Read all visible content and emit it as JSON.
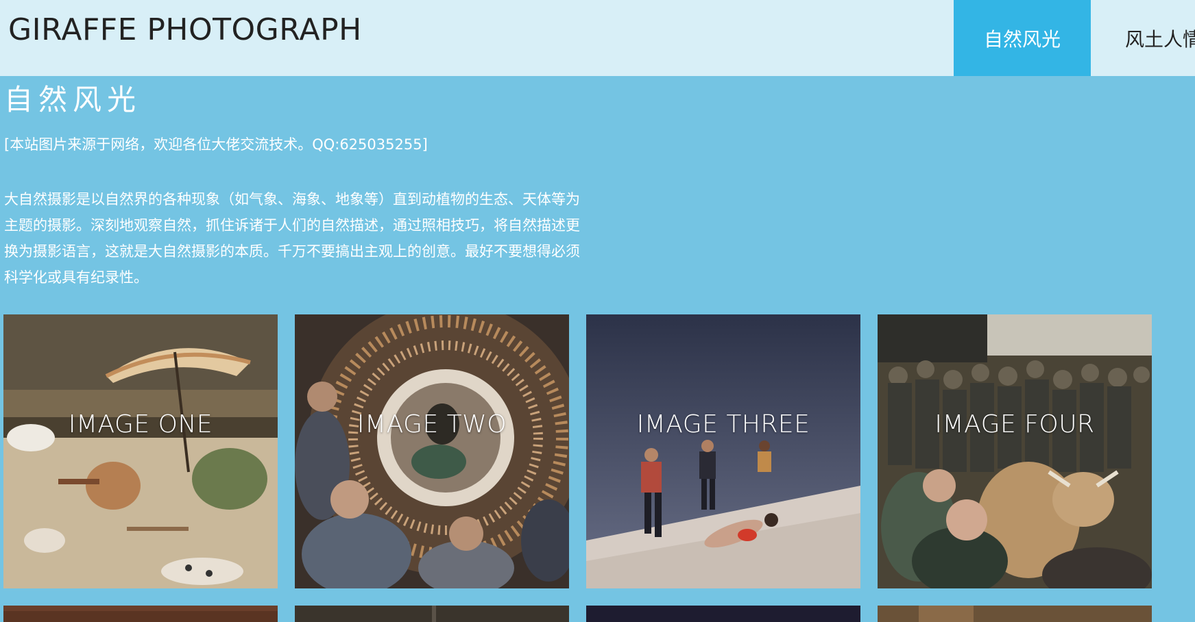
{
  "header": {
    "site_title": "GIRAFFE PHOTOGRAPH",
    "nav": [
      {
        "label": "自然风光",
        "active": true
      },
      {
        "label": "风土人情",
        "active": false
      }
    ]
  },
  "section": {
    "title": "自然风光",
    "notice": "[本站图片来源于网络，欢迎各位大佬交流技术。QQ:625035255]",
    "description": "大自然摄影是以自然界的各种现象（如气象、海象、地象等）直到动植物的生态、天体等为主题的摄影。深刻地观察自然，抓住诉诸于人们的自然描述，通过照相技巧，将自然描述更换为摄影语言，这就是大自然摄影的本质。千万不要搞出主观上的创意。最好不要想得必须科学化或具有纪录性。"
  },
  "gallery": {
    "tiles": [
      {
        "label": "IMAGE ONE"
      },
      {
        "label": "IMAGE TWO"
      },
      {
        "label": "IMAGE THREE"
      },
      {
        "label": "IMAGE FOUR"
      }
    ]
  },
  "colors": {
    "background": "#74c4e3",
    "header_bg": "#d8eff7",
    "nav_active": "#33b5e5",
    "text_light": "#ffffff",
    "text_dark": "#222222"
  }
}
